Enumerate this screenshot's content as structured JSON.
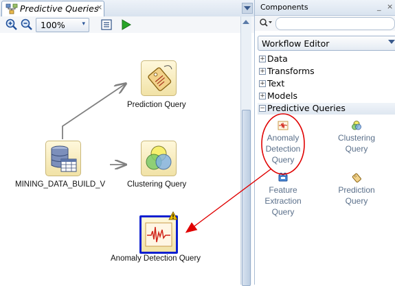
{
  "editor": {
    "tab_title": "Predictive Queries",
    "tab_close_glyph": "×",
    "zoom": {
      "value": "100%",
      "arrow": "▾"
    },
    "nodes": [
      {
        "id": "mining-data",
        "label": "MINING_DATA_BUILD_V",
        "icon": "database-table-icon"
      },
      {
        "id": "prediction-query",
        "label": "Prediction Query",
        "icon": "tag-icon"
      },
      {
        "id": "clustering-query",
        "label": "Clustering Query",
        "icon": "clustering-icon"
      },
      {
        "id": "anomaly-detection-query",
        "label": "Anomaly Detection Query",
        "icon": "anomaly-icon",
        "warning": true,
        "selected": true
      }
    ],
    "colors": {
      "selection_border": "#0a1fd0",
      "warning": "#f2c200",
      "connector": "#808080"
    }
  },
  "components": {
    "panel_title": "Components",
    "min_glyph": "_",
    "close_glyph": "×",
    "search_icon_glyph": "Q▾",
    "palette_select": "Workflow Editor",
    "categories": [
      {
        "label": "Data",
        "expanded": false
      },
      {
        "label": "Transforms",
        "expanded": false
      },
      {
        "label": "Text",
        "expanded": false
      },
      {
        "label": "Models",
        "expanded": false
      },
      {
        "label": "Predictive Queries",
        "expanded": true
      }
    ],
    "expand_glyph": "+",
    "collapse_glyph": "−",
    "items": [
      {
        "lines": [
          "Anomaly",
          "Detection",
          "Query"
        ],
        "icon": "anomaly-icon"
      },
      {
        "lines": [
          "Clustering",
          "Query"
        ],
        "icon": "clustering-icon"
      },
      {
        "lines": [
          "Feature",
          "Extraction",
          "Query"
        ],
        "icon": "feature-extraction-icon"
      },
      {
        "lines": [
          "Prediction",
          "Query"
        ],
        "icon": "tag-icon"
      }
    ]
  },
  "annotation": {
    "color": "#e00000"
  }
}
